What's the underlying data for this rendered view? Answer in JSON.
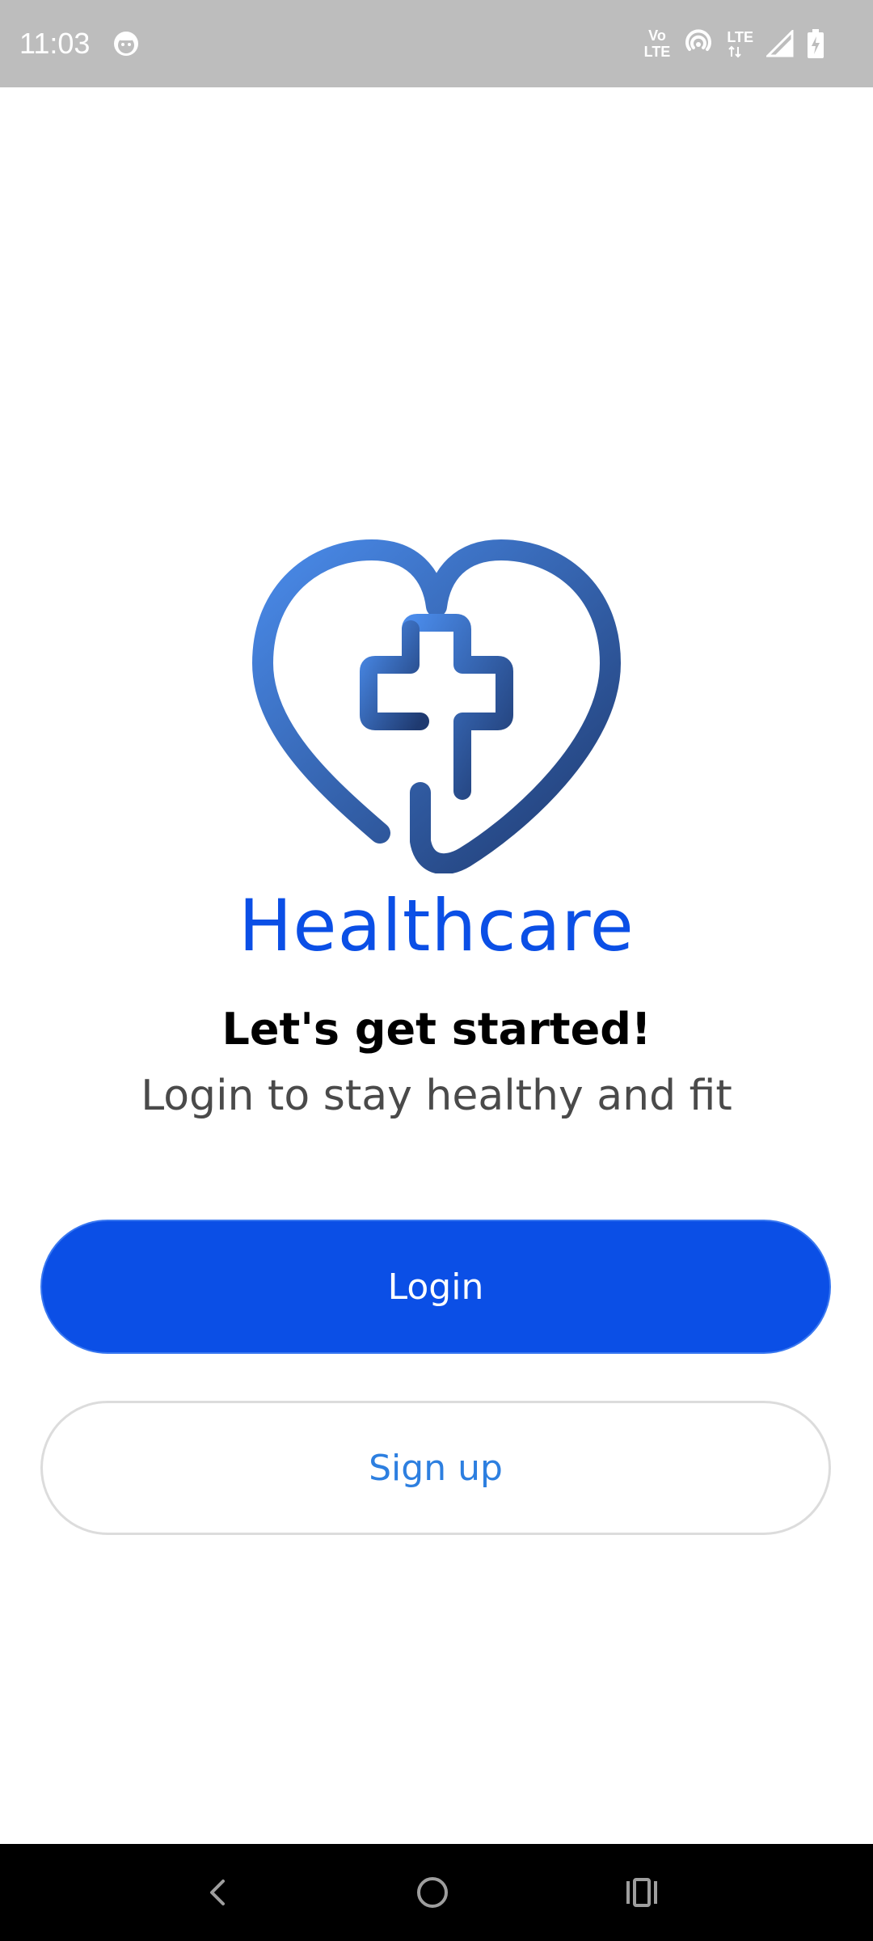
{
  "status_bar": {
    "time": "11:03",
    "volte_label_top": "Vo",
    "volte_label_bottom": "LTE",
    "lte_label": "LTE",
    "icons": [
      "face-notification-icon",
      "volte-icon",
      "hotspot-icon",
      "lte-icon",
      "signal-icon",
      "battery-charging-icon"
    ]
  },
  "app": {
    "title": "Healthcare",
    "headline": "Let's get started!",
    "subline": "Login to stay healthy and fit",
    "logo_icon": "heart-cross-icon"
  },
  "buttons": {
    "login_label": "Login",
    "signup_label": "Sign up"
  },
  "nav_bar": {
    "icons": [
      "back-icon",
      "home-icon",
      "recents-icon"
    ]
  },
  "colors": {
    "primary": "#0b4fe6",
    "signup_text": "#2d7fe0",
    "status_bar": "#bdbdbd",
    "nav_bar": "#000000",
    "logo_gradient_start": "#4a8bea",
    "logo_gradient_end": "#1f3a70"
  }
}
